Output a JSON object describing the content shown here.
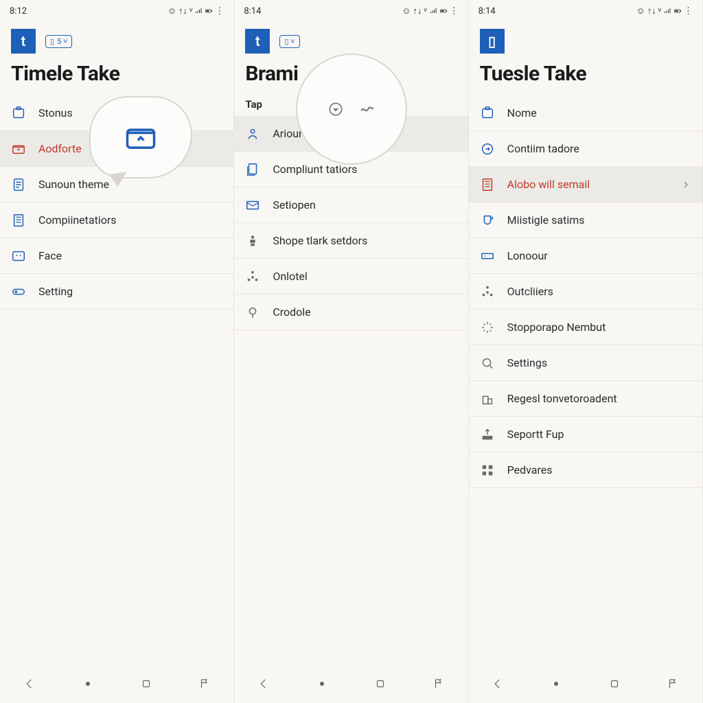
{
  "screens": [
    {
      "time": "8:12",
      "app_glyph": "t",
      "chip": "5 ˅",
      "title": "Timele Take",
      "items": [
        {
          "icon": "badge-icon",
          "label": "Stonus"
        },
        {
          "icon": "folder-icon",
          "label": "Aodforte",
          "selected": true,
          "red": true
        },
        {
          "icon": "doc-icon",
          "label": "Sunoun theme"
        },
        {
          "icon": "doc-lines-icon",
          "label": "Compiinetatiors"
        },
        {
          "icon": "face-icon",
          "label": "Face"
        },
        {
          "icon": "toggle-icon",
          "label": "Setting"
        }
      ]
    },
    {
      "time": "8:14",
      "app_glyph": "t",
      "chip": "▯ ˅",
      "title": "Brami",
      "section": "Tap",
      "items": [
        {
          "icon": "person-icon",
          "label": "Ariour",
          "selected": true
        },
        {
          "icon": "doc-stack-icon",
          "label": "Compliunt tatiors"
        },
        {
          "icon": "mail-icon",
          "label": "Setiopen"
        },
        {
          "icon": "shape-icon",
          "label": "Shope tlark setdors",
          "gray": true
        },
        {
          "icon": "nodes-icon",
          "label": "Onlotel",
          "gray": true
        },
        {
          "icon": "pin-icon",
          "label": "Crodole",
          "gray": true
        }
      ]
    },
    {
      "time": "8:14",
      "app_glyph": "▯",
      "title": "Tuesle Take",
      "items": [
        {
          "icon": "badge-icon",
          "label": "Nome"
        },
        {
          "icon": "circle-arrow-icon",
          "label": "Contiim tadore"
        },
        {
          "icon": "doc-lines-icon",
          "label": "Alobo will semail",
          "selected": true,
          "red": true,
          "chevron": true
        },
        {
          "icon": "cup-icon",
          "label": "Miistigle satims"
        },
        {
          "icon": "card-icon",
          "label": "Lonoour"
        },
        {
          "icon": "nodes-icon",
          "label": "Outcliiers",
          "gray": true
        },
        {
          "icon": "spark-icon",
          "label": "Stopporapo Nembut",
          "gray": true
        },
        {
          "icon": "search-icon",
          "label": "Settings",
          "gray": true
        },
        {
          "icon": "building-icon",
          "label": "Regesl tonvetoroadent",
          "gray": true
        },
        {
          "icon": "upload-icon",
          "label": "Seportt Fup",
          "gray": true
        },
        {
          "icon": "grid-icon",
          "label": "Pedvares",
          "gray": true
        }
      ]
    }
  ]
}
